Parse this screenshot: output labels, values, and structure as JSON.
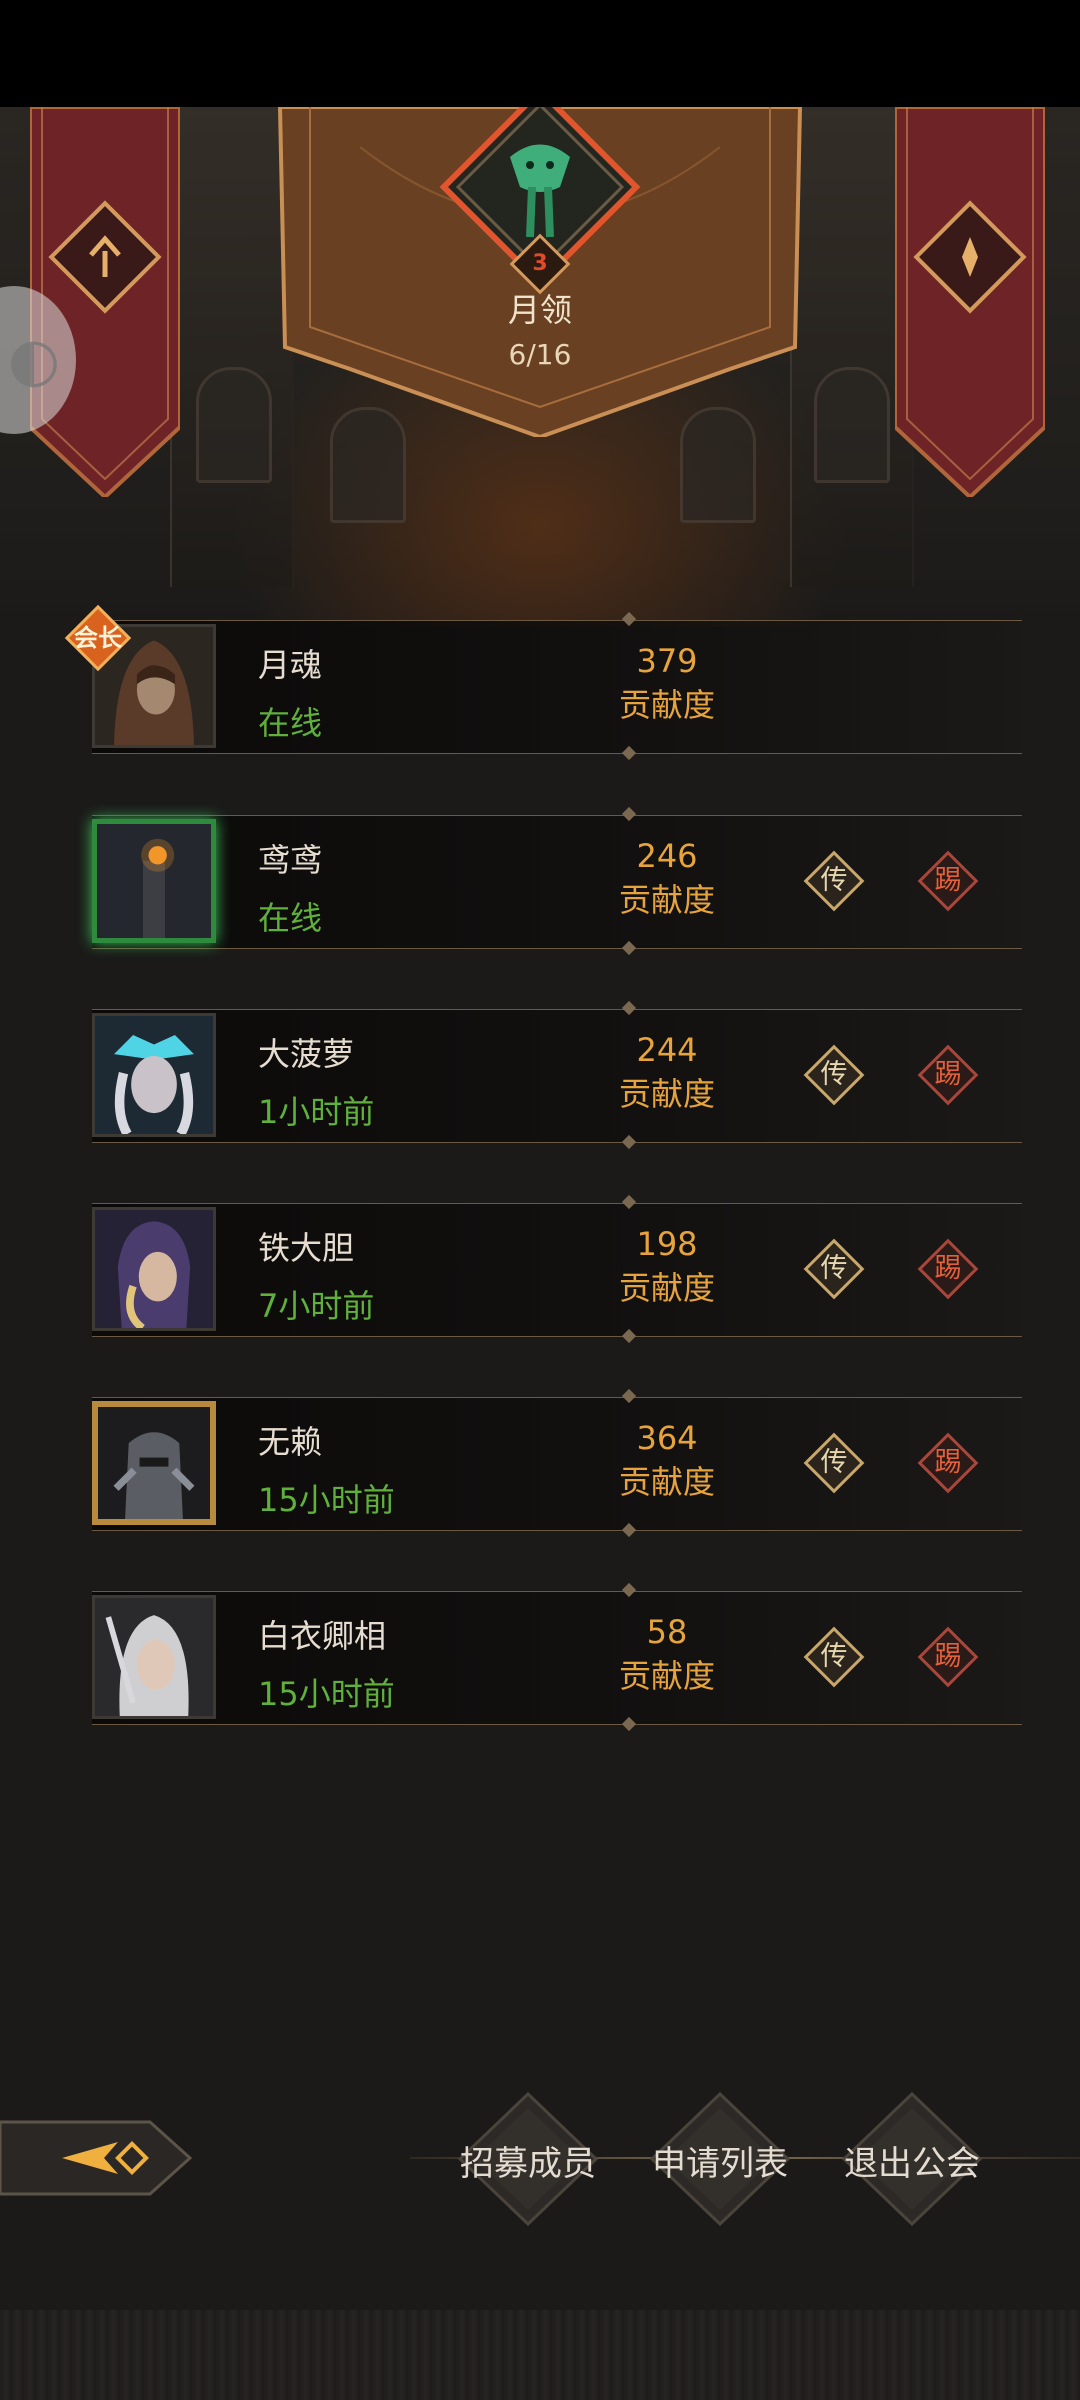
{
  "guild": {
    "level": "3",
    "name": "月领",
    "member_count": "6/16"
  },
  "labels": {
    "contribution": "贡献度",
    "leader_badge": "会长",
    "transfer": "传",
    "kick": "踢"
  },
  "members": [
    {
      "name": "月魂",
      "status": "在线",
      "contribution": "379"
    },
    {
      "name": "鸢鸢",
      "status": "在线",
      "contribution": "246"
    },
    {
      "name": "大菠萝",
      "status": "1小时前",
      "contribution": "244"
    },
    {
      "name": "铁大胆",
      "status": "7小时前",
      "contribution": "198"
    },
    {
      "name": "无赖",
      "status": "15小时前",
      "contribution": "364"
    },
    {
      "name": "白衣卿相",
      "status": "15小时前",
      "contribution": "58"
    }
  ],
  "bottom_buttons": {
    "recruit": "招募成员",
    "applications": "申请列表",
    "leave": "退出公会"
  },
  "colors": {
    "online": "#5fb13c",
    "contribution": "#e8a43c",
    "kick": "#e2603a",
    "banner": "#7c2a2c"
  }
}
